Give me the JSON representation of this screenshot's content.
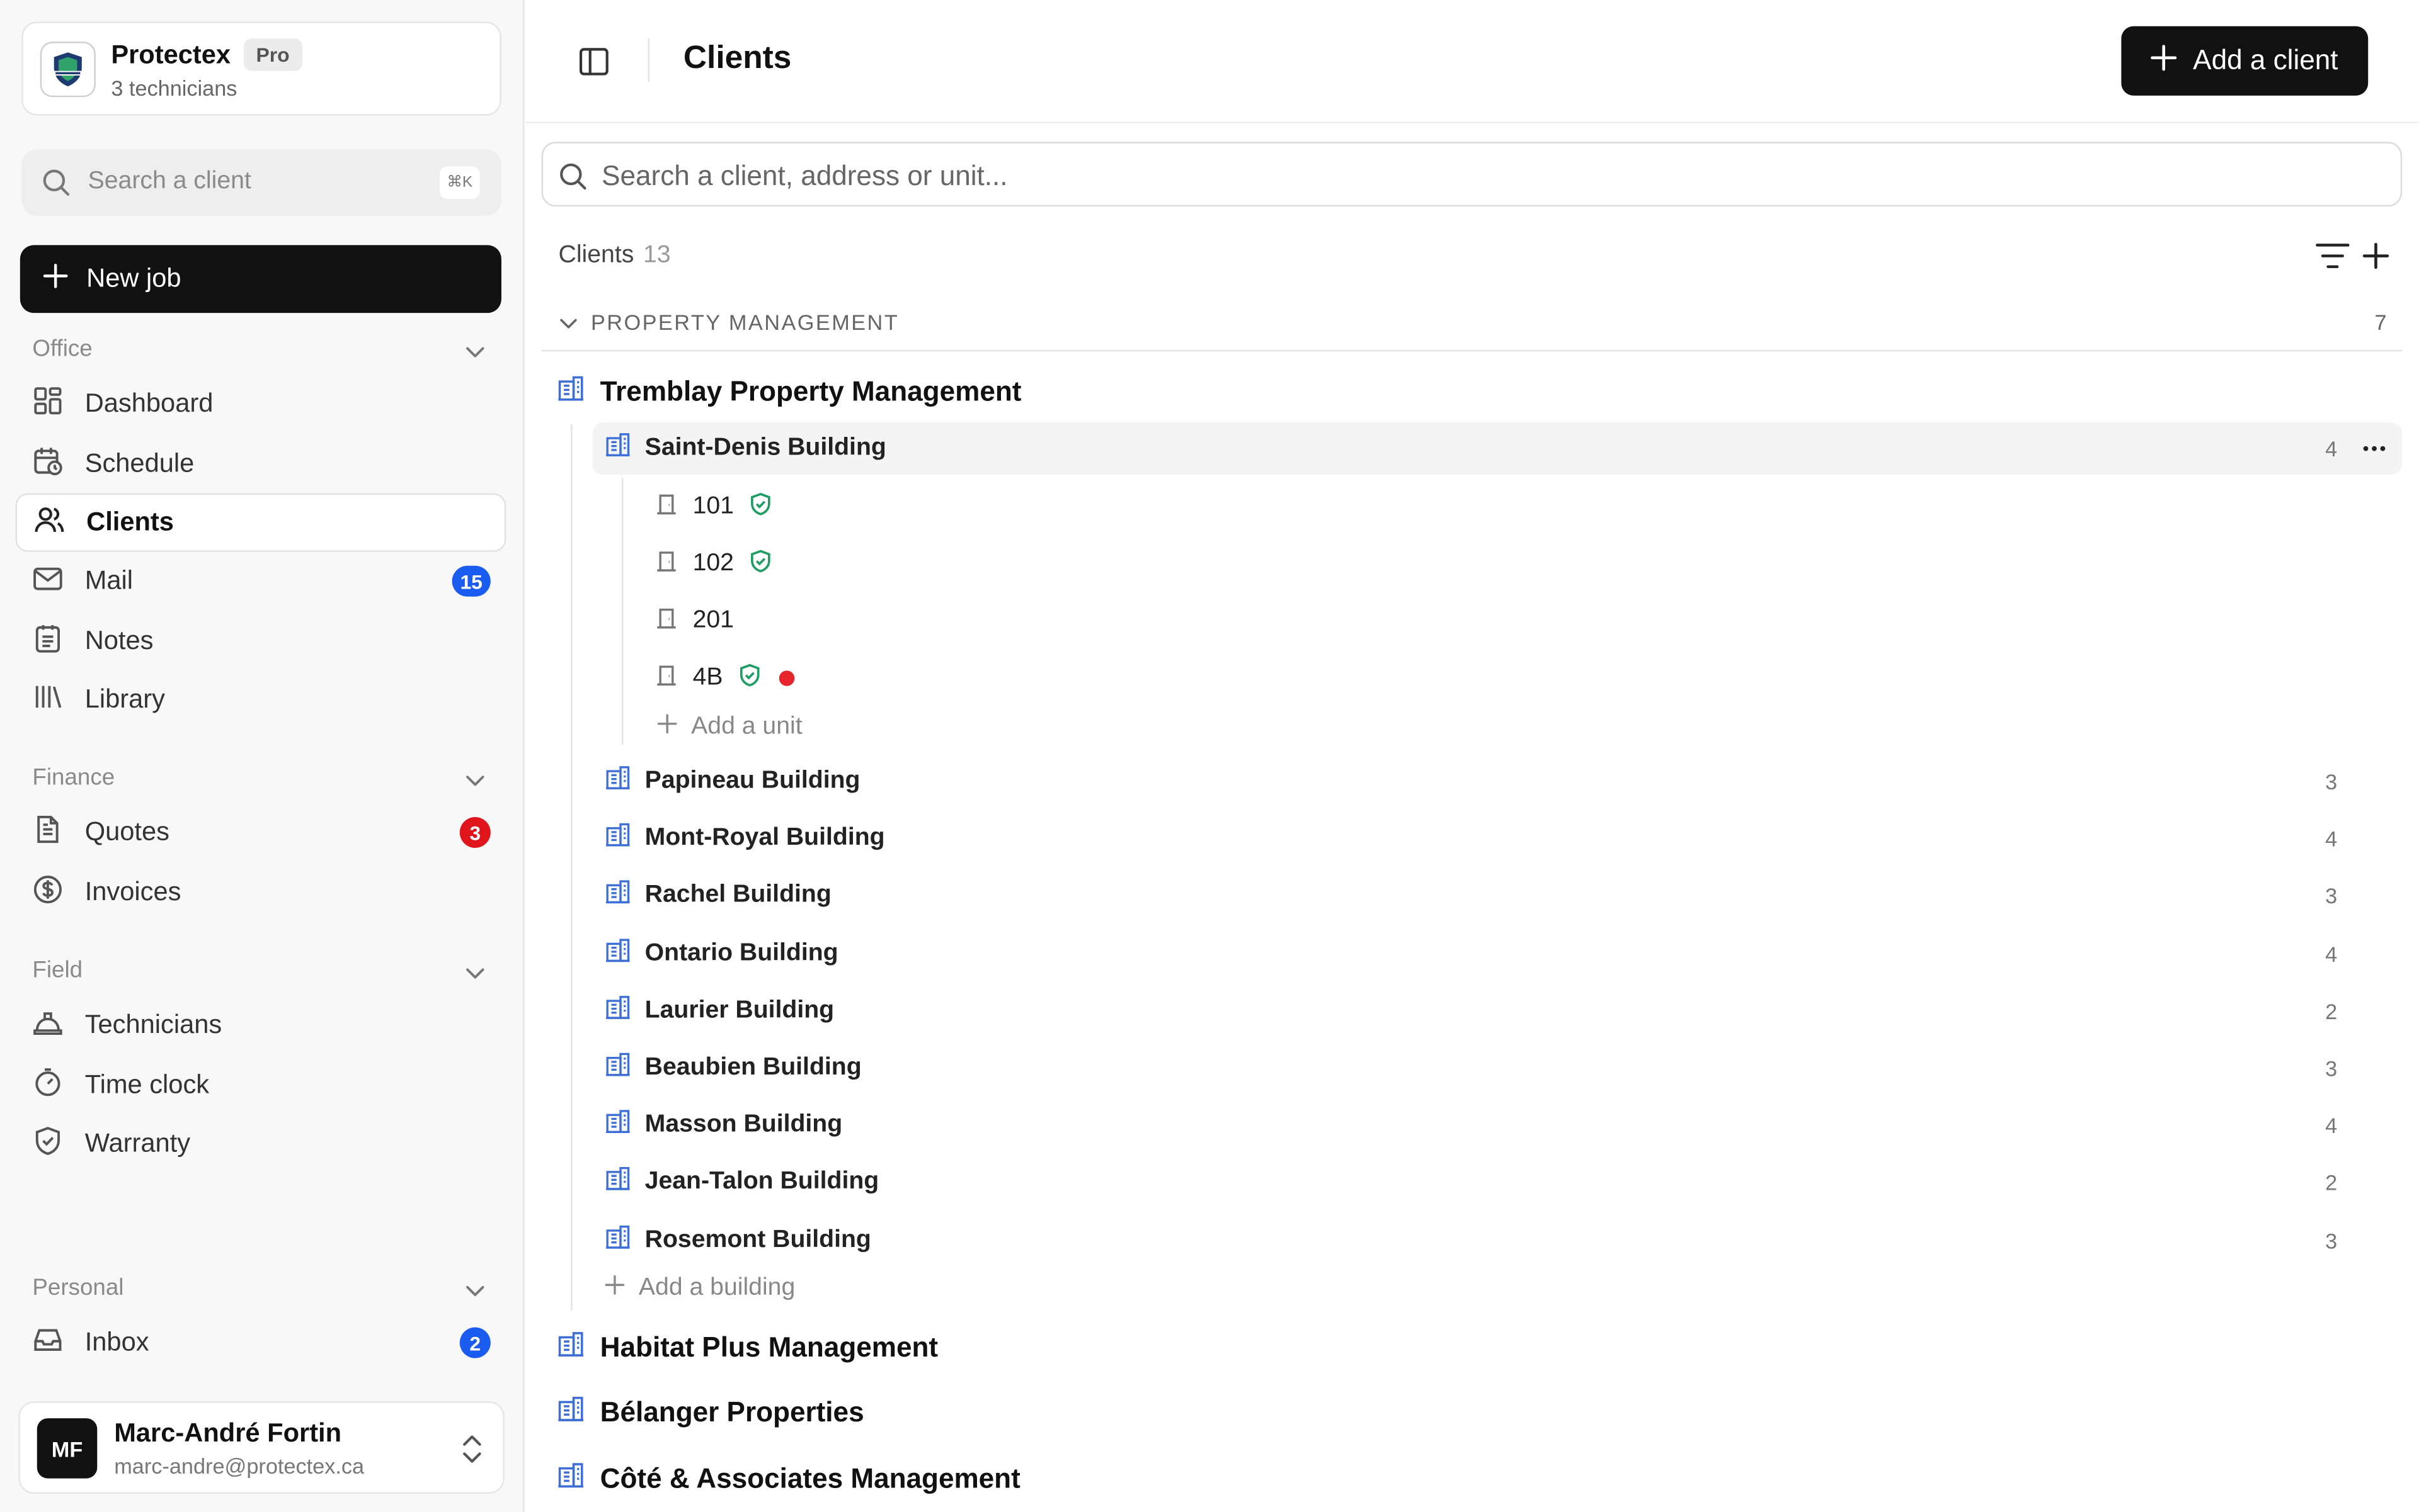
{
  "colors": {
    "accent_dark": "#111111",
    "badge_blue": "#1a5cf0",
    "badge_red": "#e0141b",
    "warranty_green": "#1f9d63",
    "building_blue": "#3d6fd6",
    "status_red": "#e5242b"
  },
  "org": {
    "name": "Protectex",
    "plan_badge": "Pro",
    "subtitle": "3 technicians",
    "logo_icon": "shield-logo"
  },
  "sidebar_search": {
    "placeholder": "Search a client",
    "shortcut": "⌘K"
  },
  "new_job_label": "New job",
  "sections": {
    "office": "Office",
    "finance": "Finance",
    "field": "Field",
    "personal": "Personal"
  },
  "nav": {
    "dashboard": "Dashboard",
    "schedule": "Schedule",
    "clients": "Clients",
    "mail": "Mail",
    "mail_count": "15",
    "notes": "Notes",
    "library": "Library",
    "quotes": "Quotes",
    "quotes_count": "3",
    "invoices": "Invoices",
    "technicians": "Technicians",
    "time_clock": "Time clock",
    "warranty": "Warranty",
    "inbox": "Inbox",
    "inbox_count": "2"
  },
  "user": {
    "initials": "MF",
    "name": "Marc-André Fortin",
    "email": "marc-andre@protectex.ca"
  },
  "header": {
    "title": "Clients",
    "add_client_label": "Add a client"
  },
  "main_search": {
    "placeholder": "Search a client, address or unit..."
  },
  "list": {
    "heading": "Clients",
    "count": "13",
    "group": {
      "label": "PROPERTY MANAGEMENT",
      "count": "7"
    },
    "expanded_client": "Tremblay Property Management",
    "selected_building": {
      "name": "Saint-Denis Building",
      "count": "4"
    },
    "units": [
      {
        "label": "101",
        "warranty": true,
        "alert": false
      },
      {
        "label": "102",
        "warranty": true,
        "alert": false
      },
      {
        "label": "201",
        "warranty": false,
        "alert": false
      },
      {
        "label": "4B",
        "warranty": true,
        "alert": true
      }
    ],
    "add_unit_label": "Add a unit",
    "buildings": [
      {
        "name": "Papineau Building",
        "count": "3"
      },
      {
        "name": "Mont-Royal Building",
        "count": "4"
      },
      {
        "name": "Rachel Building",
        "count": "3"
      },
      {
        "name": "Ontario Building",
        "count": "4"
      },
      {
        "name": "Laurier Building",
        "count": "2"
      },
      {
        "name": "Beaubien Building",
        "count": "3"
      },
      {
        "name": "Masson Building",
        "count": "4"
      },
      {
        "name": "Jean-Talon Building",
        "count": "2"
      },
      {
        "name": "Rosemont Building",
        "count": "3"
      }
    ],
    "add_building_label": "Add a building",
    "other_clients": [
      "Habitat Plus Management",
      "Bélanger Properties",
      "Côté & Associates Management"
    ]
  }
}
